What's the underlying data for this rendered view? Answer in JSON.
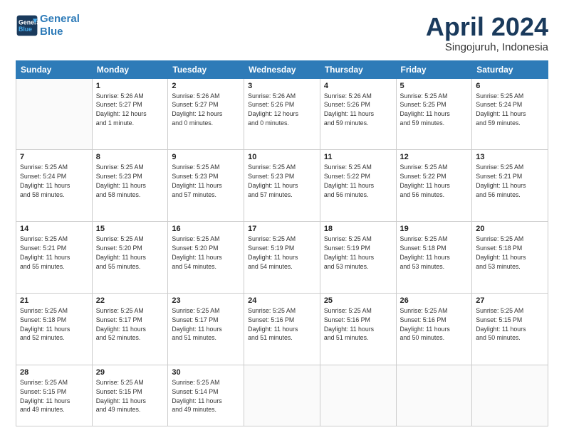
{
  "header": {
    "logo_line1": "General",
    "logo_line2": "Blue",
    "month": "April 2024",
    "location": "Singojuruh, Indonesia"
  },
  "days_of_week": [
    "Sunday",
    "Monday",
    "Tuesday",
    "Wednesday",
    "Thursday",
    "Friday",
    "Saturday"
  ],
  "weeks": [
    [
      {
        "day": "",
        "info": ""
      },
      {
        "day": "1",
        "info": "Sunrise: 5:26 AM\nSunset: 5:27 PM\nDaylight: 12 hours\nand 1 minute."
      },
      {
        "day": "2",
        "info": "Sunrise: 5:26 AM\nSunset: 5:27 PM\nDaylight: 12 hours\nand 0 minutes."
      },
      {
        "day": "3",
        "info": "Sunrise: 5:26 AM\nSunset: 5:26 PM\nDaylight: 12 hours\nand 0 minutes."
      },
      {
        "day": "4",
        "info": "Sunrise: 5:26 AM\nSunset: 5:26 PM\nDaylight: 11 hours\nand 59 minutes."
      },
      {
        "day": "5",
        "info": "Sunrise: 5:25 AM\nSunset: 5:25 PM\nDaylight: 11 hours\nand 59 minutes."
      },
      {
        "day": "6",
        "info": "Sunrise: 5:25 AM\nSunset: 5:24 PM\nDaylight: 11 hours\nand 59 minutes."
      }
    ],
    [
      {
        "day": "7",
        "info": "Sunrise: 5:25 AM\nSunset: 5:24 PM\nDaylight: 11 hours\nand 58 minutes."
      },
      {
        "day": "8",
        "info": "Sunrise: 5:25 AM\nSunset: 5:23 PM\nDaylight: 11 hours\nand 58 minutes."
      },
      {
        "day": "9",
        "info": "Sunrise: 5:25 AM\nSunset: 5:23 PM\nDaylight: 11 hours\nand 57 minutes."
      },
      {
        "day": "10",
        "info": "Sunrise: 5:25 AM\nSunset: 5:23 PM\nDaylight: 11 hours\nand 57 minutes."
      },
      {
        "day": "11",
        "info": "Sunrise: 5:25 AM\nSunset: 5:22 PM\nDaylight: 11 hours\nand 56 minutes."
      },
      {
        "day": "12",
        "info": "Sunrise: 5:25 AM\nSunset: 5:22 PM\nDaylight: 11 hours\nand 56 minutes."
      },
      {
        "day": "13",
        "info": "Sunrise: 5:25 AM\nSunset: 5:21 PM\nDaylight: 11 hours\nand 56 minutes."
      }
    ],
    [
      {
        "day": "14",
        "info": "Sunrise: 5:25 AM\nSunset: 5:21 PM\nDaylight: 11 hours\nand 55 minutes."
      },
      {
        "day": "15",
        "info": "Sunrise: 5:25 AM\nSunset: 5:20 PM\nDaylight: 11 hours\nand 55 minutes."
      },
      {
        "day": "16",
        "info": "Sunrise: 5:25 AM\nSunset: 5:20 PM\nDaylight: 11 hours\nand 54 minutes."
      },
      {
        "day": "17",
        "info": "Sunrise: 5:25 AM\nSunset: 5:19 PM\nDaylight: 11 hours\nand 54 minutes."
      },
      {
        "day": "18",
        "info": "Sunrise: 5:25 AM\nSunset: 5:19 PM\nDaylight: 11 hours\nand 53 minutes."
      },
      {
        "day": "19",
        "info": "Sunrise: 5:25 AM\nSunset: 5:18 PM\nDaylight: 11 hours\nand 53 minutes."
      },
      {
        "day": "20",
        "info": "Sunrise: 5:25 AM\nSunset: 5:18 PM\nDaylight: 11 hours\nand 53 minutes."
      }
    ],
    [
      {
        "day": "21",
        "info": "Sunrise: 5:25 AM\nSunset: 5:18 PM\nDaylight: 11 hours\nand 52 minutes."
      },
      {
        "day": "22",
        "info": "Sunrise: 5:25 AM\nSunset: 5:17 PM\nDaylight: 11 hours\nand 52 minutes."
      },
      {
        "day": "23",
        "info": "Sunrise: 5:25 AM\nSunset: 5:17 PM\nDaylight: 11 hours\nand 51 minutes."
      },
      {
        "day": "24",
        "info": "Sunrise: 5:25 AM\nSunset: 5:16 PM\nDaylight: 11 hours\nand 51 minutes."
      },
      {
        "day": "25",
        "info": "Sunrise: 5:25 AM\nSunset: 5:16 PM\nDaylight: 11 hours\nand 51 minutes."
      },
      {
        "day": "26",
        "info": "Sunrise: 5:25 AM\nSunset: 5:16 PM\nDaylight: 11 hours\nand 50 minutes."
      },
      {
        "day": "27",
        "info": "Sunrise: 5:25 AM\nSunset: 5:15 PM\nDaylight: 11 hours\nand 50 minutes."
      }
    ],
    [
      {
        "day": "28",
        "info": "Sunrise: 5:25 AM\nSunset: 5:15 PM\nDaylight: 11 hours\nand 49 minutes."
      },
      {
        "day": "29",
        "info": "Sunrise: 5:25 AM\nSunset: 5:15 PM\nDaylight: 11 hours\nand 49 minutes."
      },
      {
        "day": "30",
        "info": "Sunrise: 5:25 AM\nSunset: 5:14 PM\nDaylight: 11 hours\nand 49 minutes."
      },
      {
        "day": "",
        "info": ""
      },
      {
        "day": "",
        "info": ""
      },
      {
        "day": "",
        "info": ""
      },
      {
        "day": "",
        "info": ""
      }
    ]
  ]
}
